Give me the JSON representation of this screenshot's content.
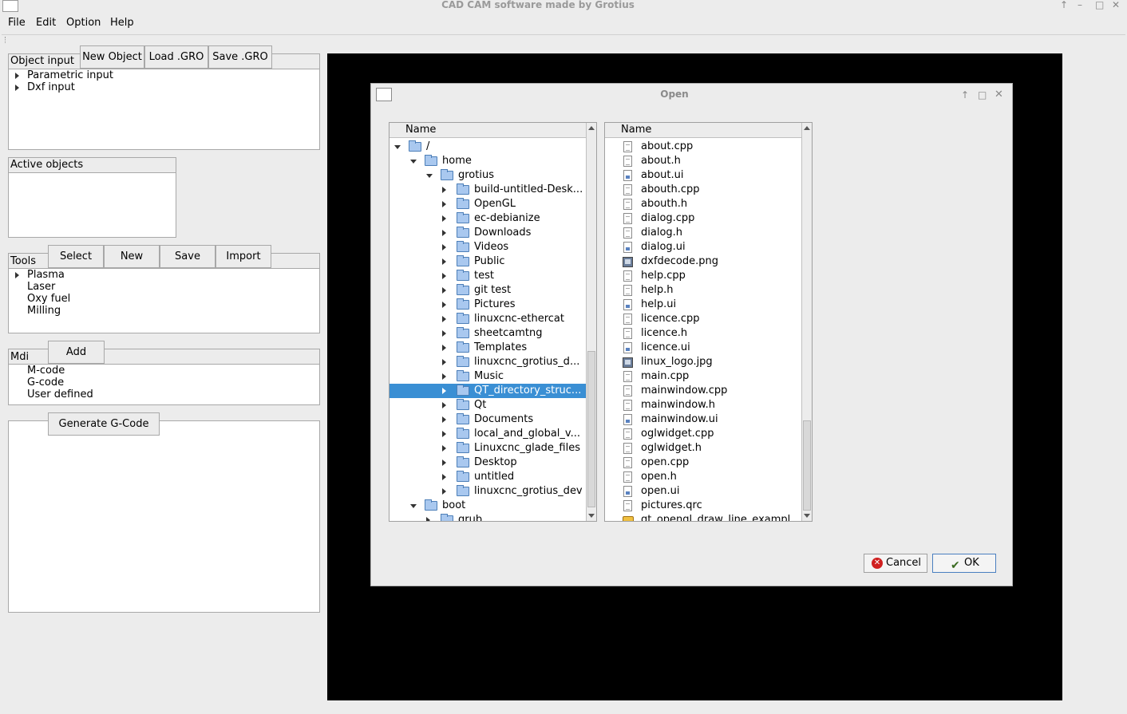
{
  "window": {
    "title": "CAD CAM software made by Grotius"
  },
  "menu": [
    "File",
    "Edit",
    "Option",
    "Help"
  ],
  "object_input": {
    "label": "Object input",
    "buttons": [
      "New Object",
      "Load .GRO",
      "Save .GRO"
    ],
    "items": [
      "Parametric input",
      "Dxf input"
    ]
  },
  "active_objects": {
    "label": "Active objects"
  },
  "tools": {
    "label": "Tools",
    "buttons": [
      "Select",
      "New",
      "Save",
      "Import"
    ],
    "items": [
      "Plasma",
      "Laser",
      "Oxy fuel",
      "Milling"
    ]
  },
  "mdi": {
    "label": "Mdi",
    "buttons": [
      "Add"
    ],
    "items": [
      "M-code",
      "G-code",
      "User defined"
    ]
  },
  "gcode": {
    "button": "Generate G-Code"
  },
  "dialog": {
    "title": "Open",
    "dir_header": "Name",
    "file_header": "Name",
    "dirs": [
      {
        "name": "/",
        "level": 0,
        "state": "open"
      },
      {
        "name": "home",
        "level": 1,
        "state": "open"
      },
      {
        "name": "grotius",
        "level": 2,
        "state": "open"
      },
      {
        "name": "build-untitled-Desk...",
        "level": 3,
        "state": "closed"
      },
      {
        "name": "OpenGL",
        "level": 3,
        "state": "closed"
      },
      {
        "name": "ec-debianize",
        "level": 3,
        "state": "closed"
      },
      {
        "name": "Downloads",
        "level": 3,
        "state": "closed"
      },
      {
        "name": "Videos",
        "level": 3,
        "state": "closed"
      },
      {
        "name": "Public",
        "level": 3,
        "state": "closed"
      },
      {
        "name": "test",
        "level": 3,
        "state": "closed"
      },
      {
        "name": "git test",
        "level": 3,
        "state": "closed"
      },
      {
        "name": "Pictures",
        "level": 3,
        "state": "closed"
      },
      {
        "name": "linuxcnc-ethercat",
        "level": 3,
        "state": "closed"
      },
      {
        "name": "sheetcamtng",
        "level": 3,
        "state": "closed"
      },
      {
        "name": "Templates",
        "level": 3,
        "state": "closed"
      },
      {
        "name": "linuxcnc_grotius_d...",
        "level": 3,
        "state": "closed"
      },
      {
        "name": "Music",
        "level": 3,
        "state": "closed"
      },
      {
        "name": "QT_directory_struc...",
        "level": 3,
        "state": "closed",
        "selected": true
      },
      {
        "name": "Qt",
        "level": 3,
        "state": "closed"
      },
      {
        "name": "Documents",
        "level": 3,
        "state": "closed"
      },
      {
        "name": "local_and_global_v...",
        "level": 3,
        "state": "closed"
      },
      {
        "name": "Linuxcnc_glade_files",
        "level": 3,
        "state": "closed"
      },
      {
        "name": "Desktop",
        "level": 3,
        "state": "closed"
      },
      {
        "name": "untitled",
        "level": 3,
        "state": "closed"
      },
      {
        "name": "linuxcnc_grotius_dev",
        "level": 3,
        "state": "closed"
      },
      {
        "name": "boot",
        "level": 1,
        "state": "open"
      },
      {
        "name": "grub",
        "level": 2,
        "state": "closed"
      }
    ],
    "files": [
      {
        "name": "about.cpp",
        "icon": "text"
      },
      {
        "name": "about.h",
        "icon": "text"
      },
      {
        "name": "about.ui",
        "icon": "ui"
      },
      {
        "name": "abouth.cpp",
        "icon": "text"
      },
      {
        "name": "abouth.h",
        "icon": "text"
      },
      {
        "name": "dialog.cpp",
        "icon": "text"
      },
      {
        "name": "dialog.h",
        "icon": "text"
      },
      {
        "name": "dialog.ui",
        "icon": "ui"
      },
      {
        "name": "dxfdecode.png",
        "icon": "image"
      },
      {
        "name": "help.cpp",
        "icon": "text"
      },
      {
        "name": "help.h",
        "icon": "text"
      },
      {
        "name": "help.ui",
        "icon": "ui"
      },
      {
        "name": "licence.cpp",
        "icon": "text"
      },
      {
        "name": "licence.h",
        "icon": "text"
      },
      {
        "name": "licence.ui",
        "icon": "ui"
      },
      {
        "name": "linux_logo.jpg",
        "icon": "image"
      },
      {
        "name": "main.cpp",
        "icon": "text"
      },
      {
        "name": "mainwindow.cpp",
        "icon": "text"
      },
      {
        "name": "mainwindow.h",
        "icon": "text"
      },
      {
        "name": "mainwindow.ui",
        "icon": "ui"
      },
      {
        "name": "oglwidget.cpp",
        "icon": "text"
      },
      {
        "name": "oglwidget.h",
        "icon": "text"
      },
      {
        "name": "open.cpp",
        "icon": "text"
      },
      {
        "name": "open.h",
        "icon": "text"
      },
      {
        "name": "open.ui",
        "icon": "ui"
      },
      {
        "name": "pictures.qrc",
        "icon": "text"
      },
      {
        "name": "qt_opengl_draw_line_exampl",
        "icon": "project"
      }
    ],
    "cancel": "Cancel",
    "ok": "OK"
  }
}
